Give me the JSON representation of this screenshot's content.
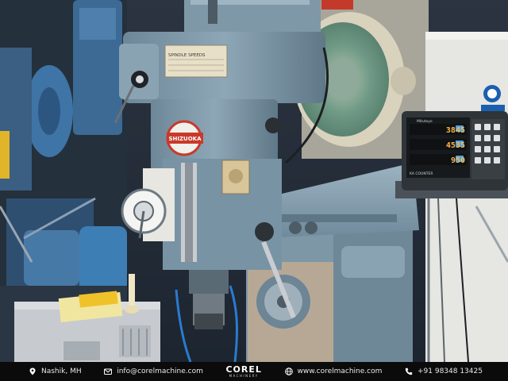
{
  "machine": {
    "brand_badge": "SHIZUOKA",
    "plate_title": "SPINDLE SPEEDS"
  },
  "dro": {
    "brand": "Mitutoyo",
    "model": "KA COUNTER",
    "readouts": [
      "3845",
      "4535",
      "950"
    ]
  },
  "footer": {
    "location": "Nashik, MH",
    "email": "info@corelmachine.com",
    "brand": "COREL",
    "brand_sub": "MACHINERY",
    "website": "www.corelmachine.com",
    "phone": "+91 98348 13425"
  },
  "colors": {
    "machine_blue": "#7d98aa",
    "footer_bg": "#0b0b0c",
    "badge_red": "#c9392b",
    "dro_digits": "#ffb84a"
  }
}
